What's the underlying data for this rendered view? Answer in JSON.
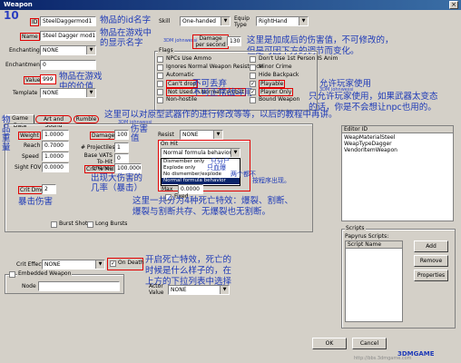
{
  "window": {
    "title": "Weapon",
    "close_label": "×"
  },
  "page_number": "10",
  "fields": {
    "id_label": "ID",
    "id_value": "SteelDaggermod1",
    "name_label": "Name",
    "name_value": "Steel Dagger mod1",
    "enchanting_label": "Enchanting",
    "enchanting_value": "NONE",
    "enchantment_label": "Enchantment",
    "enchantment_value": "0",
    "value_label": "Value",
    "value_value": "999",
    "template_label": "Template",
    "template_value": "NONE",
    "skill_label": "Skill",
    "skill_value": "One-handed",
    "equip_type_label": "Equip Type",
    "equip_type_value": "RightHand",
    "damage_per_second_label": "Damage per second",
    "damage_per_second_value": "130"
  },
  "flags": {
    "title": "Flags",
    "items": [
      {
        "label": "NPCs Use Ammo",
        "checked": false
      },
      {
        "label": "Ignores Normal Weapon Resistance",
        "checked": false
      },
      {
        "label": "Automatic",
        "checked": false
      },
      {
        "label": "Can't drop",
        "checked": false
      },
      {
        "label": "Not Used in Normal Combat",
        "checked": false
      },
      {
        "label": "Non-hostile",
        "checked": false
      }
    ],
    "items_right": [
      {
        "label": "Don't Use 1st Person IS Anim",
        "checked": false
      },
      {
        "label": "Minor Crime",
        "checked": false
      },
      {
        "label": "Hide Backpack",
        "checked": false
      },
      {
        "label": "Playable",
        "checked": true
      },
      {
        "label": "Player Only",
        "checked": true
      },
      {
        "label": "Bound Weapon",
        "checked": false
      }
    ]
  },
  "tabs": [
    "Game Data",
    "Art and Sound",
    "Rumble"
  ],
  "game_data": {
    "weight_label": "Weight",
    "weight_value": "1.0000",
    "reach_label": "Reach",
    "reach_value": "0.7000",
    "speed_label": "Speed",
    "speed_value": "1.0000",
    "sight_fov_label": "Sight FOV",
    "sight_fov_value": "0.0000",
    "crit_dmg_label": "Crit Dmg",
    "crit_dmg_value": "2",
    "damage_label": "Damage",
    "damage_value": "100",
    "projectiles_label": "# Projectiles",
    "projectiles_value": "1",
    "base_vats_label": "Base VATS To-Hit Chance",
    "base_vats_value": "0",
    "crit_mult_label": "Crit % Mult",
    "crit_mult_value": "100.0000",
    "resist_label": "Resist",
    "resist_value": "NONE",
    "on_hit_label": "On Hit",
    "on_hit_value": "Normal formula behavior",
    "on_hit_options": [
      "Normal formula behavior",
      "Dismember only",
      "Explode only",
      "No dismember/explode",
      "Normal formula behavior"
    ],
    "max_label": "Max",
    "max_value": "0.0000",
    "fixed_label": "Fixed",
    "burst_shot_label": "Burst Shot",
    "long_bursts_label": "Long Bursts"
  },
  "crit_effect": {
    "label": "Crit Effect",
    "value": "NONE",
    "on_death_label": "On Death",
    "on_death_checked": true
  },
  "embedded": {
    "label": "Embedded Weapon",
    "node_label": "Node",
    "node_value": ""
  },
  "actor_value": {
    "label": "Actor Value",
    "value": "NONE"
  },
  "editor_id": {
    "header": "Editor ID",
    "items": [
      "WeapMaterialSteel",
      "WeapTypeDagger",
      "VendorItemWeapon"
    ]
  },
  "scripts": {
    "group_label": "Scripts",
    "papyrus_label": "Papyrus Scripts:",
    "column_header": "Script Name",
    "add_label": "Add",
    "remove_label": "Remove",
    "properties_label": "Properties"
  },
  "dialog": {
    "ok_label": "OK",
    "cancel_label": "Cancel"
  },
  "annotations": {
    "id_name": "物品的id名字",
    "display_name": "物品在游戏中的显示名字",
    "value_price": "物品在游戏中的价值",
    "damage_note_1": "这里是加成后的伤害值，不可修改的，",
    "damage_note_2": "但是可因下方的调节而变化。",
    "player_only_1": "允许玩家使用",
    "player_only_2": "只允许玩家使用，如果武器太变态",
    "player_only_3": "的话，你是不会想让npc也用的。",
    "cant_drop": "不可丢弃",
    "not_normal_combat": "不可正常战斗用",
    "tab_note": "这里可以对原型武器作的进行修改等等，以后的教程中再讲。",
    "weight_note": "物品重量",
    "damage_note": "伤害值",
    "crit_chance_note": "出现大伤害的几率（暴击）",
    "crit_dmg_note": "暴击伤害",
    "dismember_only": "只分尸",
    "explode_only": "只血爆",
    "neither": "两个都不",
    "normal_formula": "按程序出现。",
    "death_types_1": "这里一共分为4种死亡特效：爆裂、割断、",
    "death_types_2": "爆裂与割断共存、无爆裂也无割断。",
    "on_death_1": "开启死亡特效，死亡的",
    "on_death_2": "时候是什么样子的，在",
    "on_death_3": "上方的下拉列表中选择",
    "watermark_1": "3DM johnwessi",
    "watermark_site": "3DMGAME",
    "watermark_url": "http://bbs.3dmgame.com"
  }
}
